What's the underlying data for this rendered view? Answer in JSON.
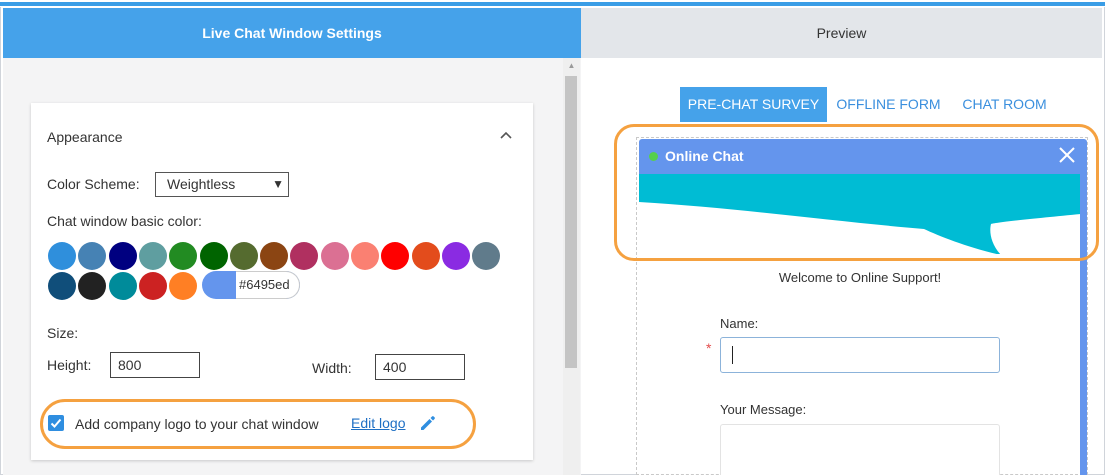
{
  "left_panel": {
    "header": "Live Chat Window Settings",
    "appearance": {
      "title": "Appearance",
      "color_scheme_label": "Color Scheme:",
      "color_scheme_value": "Weightless",
      "basic_color_label": "Chat window basic color:",
      "swatches_row1": [
        "#2f8fdc",
        "#4682b4",
        "#000080",
        "#5f9ea0",
        "#228b22",
        "#006400",
        "#556b2f",
        "#8b4513",
        "#b03060",
        "#db7093",
        "#fa8072",
        "#ff0000",
        "#e34c1c",
        "#8a2be2",
        "#607b8b"
      ],
      "swatches_row2": [
        "#104e7a",
        "#222222",
        "#008b9a",
        "#cc2222",
        "#ff7f24"
      ],
      "selected_color": "#6495ed",
      "size_label": "Size:",
      "height_label": "Height:",
      "height_value": "800",
      "width_label": "Width:",
      "width_value": "400",
      "logo_checkbox_label": "Add company logo to your chat window",
      "logo_checkbox_checked": true,
      "edit_logo_label": "Edit logo"
    }
  },
  "right_panel": {
    "header": "Preview",
    "tabs": [
      {
        "label": "PRE-CHAT SURVEY",
        "active": true
      },
      {
        "label": "OFFLINE FORM",
        "active": false
      },
      {
        "label": "CHAT ROOM",
        "active": false
      }
    ],
    "chat": {
      "title": "Online Chat",
      "status_color": "#55d04c",
      "header_color": "#6495ed",
      "banner_color": "#00bcd4",
      "welcome": "Welcome to Online Support!",
      "name_label": "Name:",
      "required_mark": "*",
      "message_label": "Your Message:"
    }
  },
  "highlight_color": "#f5a140"
}
